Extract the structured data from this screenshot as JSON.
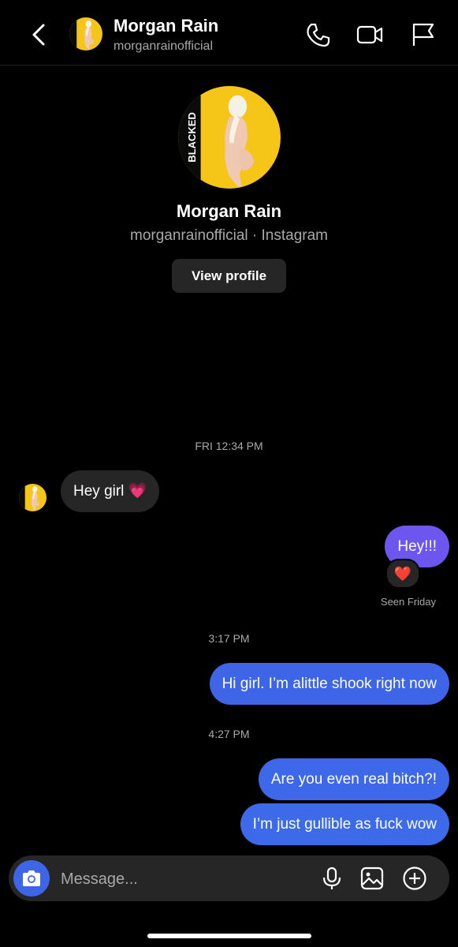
{
  "header": {
    "name": "Morgan Rain",
    "username": "morganrainofficial",
    "icons": [
      "chevron-left-icon",
      "phone-icon",
      "video-camera-icon",
      "flag-icon"
    ]
  },
  "profile": {
    "avatar_text": "BLACKED",
    "name": "Morgan Rain",
    "subtitle": "morganrainofficial · Instagram",
    "view_profile_label": "View profile"
  },
  "conversation": {
    "timestamps": [
      "FRI 12:34 PM",
      "3:17 PM",
      "4:27 PM"
    ],
    "messages": [
      {
        "from": "them",
        "text": "Hey girl 💗"
      },
      {
        "from": "me",
        "text": "Hey!!!",
        "reaction": "❤️"
      },
      {
        "from": "me",
        "text": "Hi girl. I’m alittle shook right now"
      },
      {
        "from": "me",
        "text": "Are you even real bitch?!"
      },
      {
        "from": "me",
        "text": "I’m just gullible as fuck wow"
      }
    ],
    "seen_status": "Seen Friday"
  },
  "composer": {
    "placeholder": "Message...",
    "icons": [
      "camera-icon",
      "microphone-icon",
      "gallery-icon",
      "plus-circle-icon"
    ]
  },
  "colors": {
    "background": "#000000",
    "incoming_bubble": "#262626",
    "outgoing_bubble_purple": "#6d56f0",
    "outgoing_bubble_blue": "#3e64e8",
    "secondary_text": "#a8a8a8"
  }
}
